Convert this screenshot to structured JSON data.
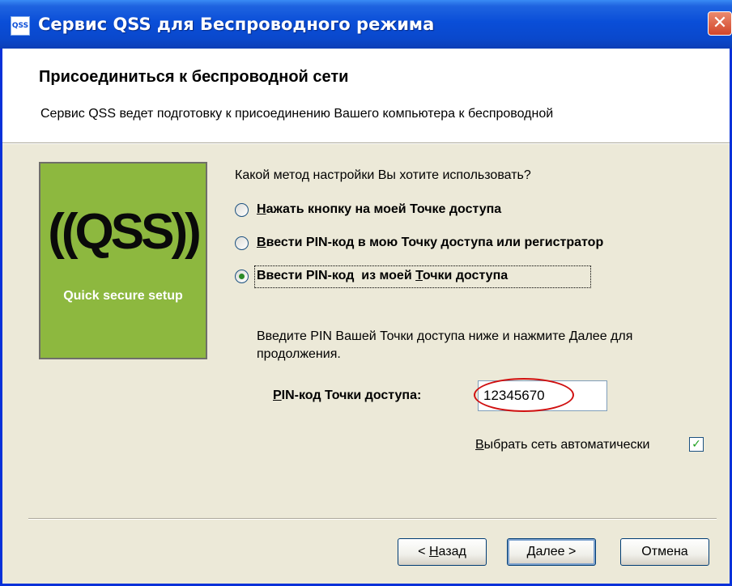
{
  "window": {
    "title": "Сервис QSS для Беспроводного режима",
    "icon_text": "QSS",
    "close_glyph": "✕"
  },
  "header": {
    "title": "Присоединиться к беспроводной сети",
    "description": "Сервис QSS ведет подготовку к присоединению Вашего компьютера к беспроводной"
  },
  "logo": {
    "mark": "((QSS))",
    "caption": "Quick secure setup",
    "background": "#8DB83F"
  },
  "method": {
    "question": "Какой метод настройки Вы хотите использовать?",
    "options": [
      {
        "mnemonic": "Н",
        "rest": "ажать кнопку на моей Точке доступа",
        "selected": false
      },
      {
        "mnemonic": "В",
        "rest": "вести PIN-код в мою Точку доступа или регистратор",
        "selected": false
      },
      {
        "pre": "Ввести PIN-код  из моей ",
        "mnemonic": "Т",
        "rest": "очки доступа",
        "selected": true
      }
    ]
  },
  "pin": {
    "hint": "Введите PIN Вашей Точки доступа ниже и нажмите Далее для продолжения.",
    "label_mnemonic": "P",
    "label_rest": "IN-код Точки доступа:",
    "value": "12345670",
    "highlight_color": "#D01010"
  },
  "auto_select": {
    "label_mnemonic": "В",
    "label_rest": "ыбрать сеть автоматически",
    "checked": true,
    "check_glyph": "✓"
  },
  "buttons": {
    "back_pre": "< ",
    "back_mnemonic": "Н",
    "back_rest": "азад",
    "next_mnemonic": "Д",
    "next_rest": "алее >",
    "cancel": "Отмена"
  },
  "colors": {
    "titlebar": "#0A4ED8",
    "dialog_bg": "#ECE9D8",
    "radio_selected": "#2B8A26"
  }
}
